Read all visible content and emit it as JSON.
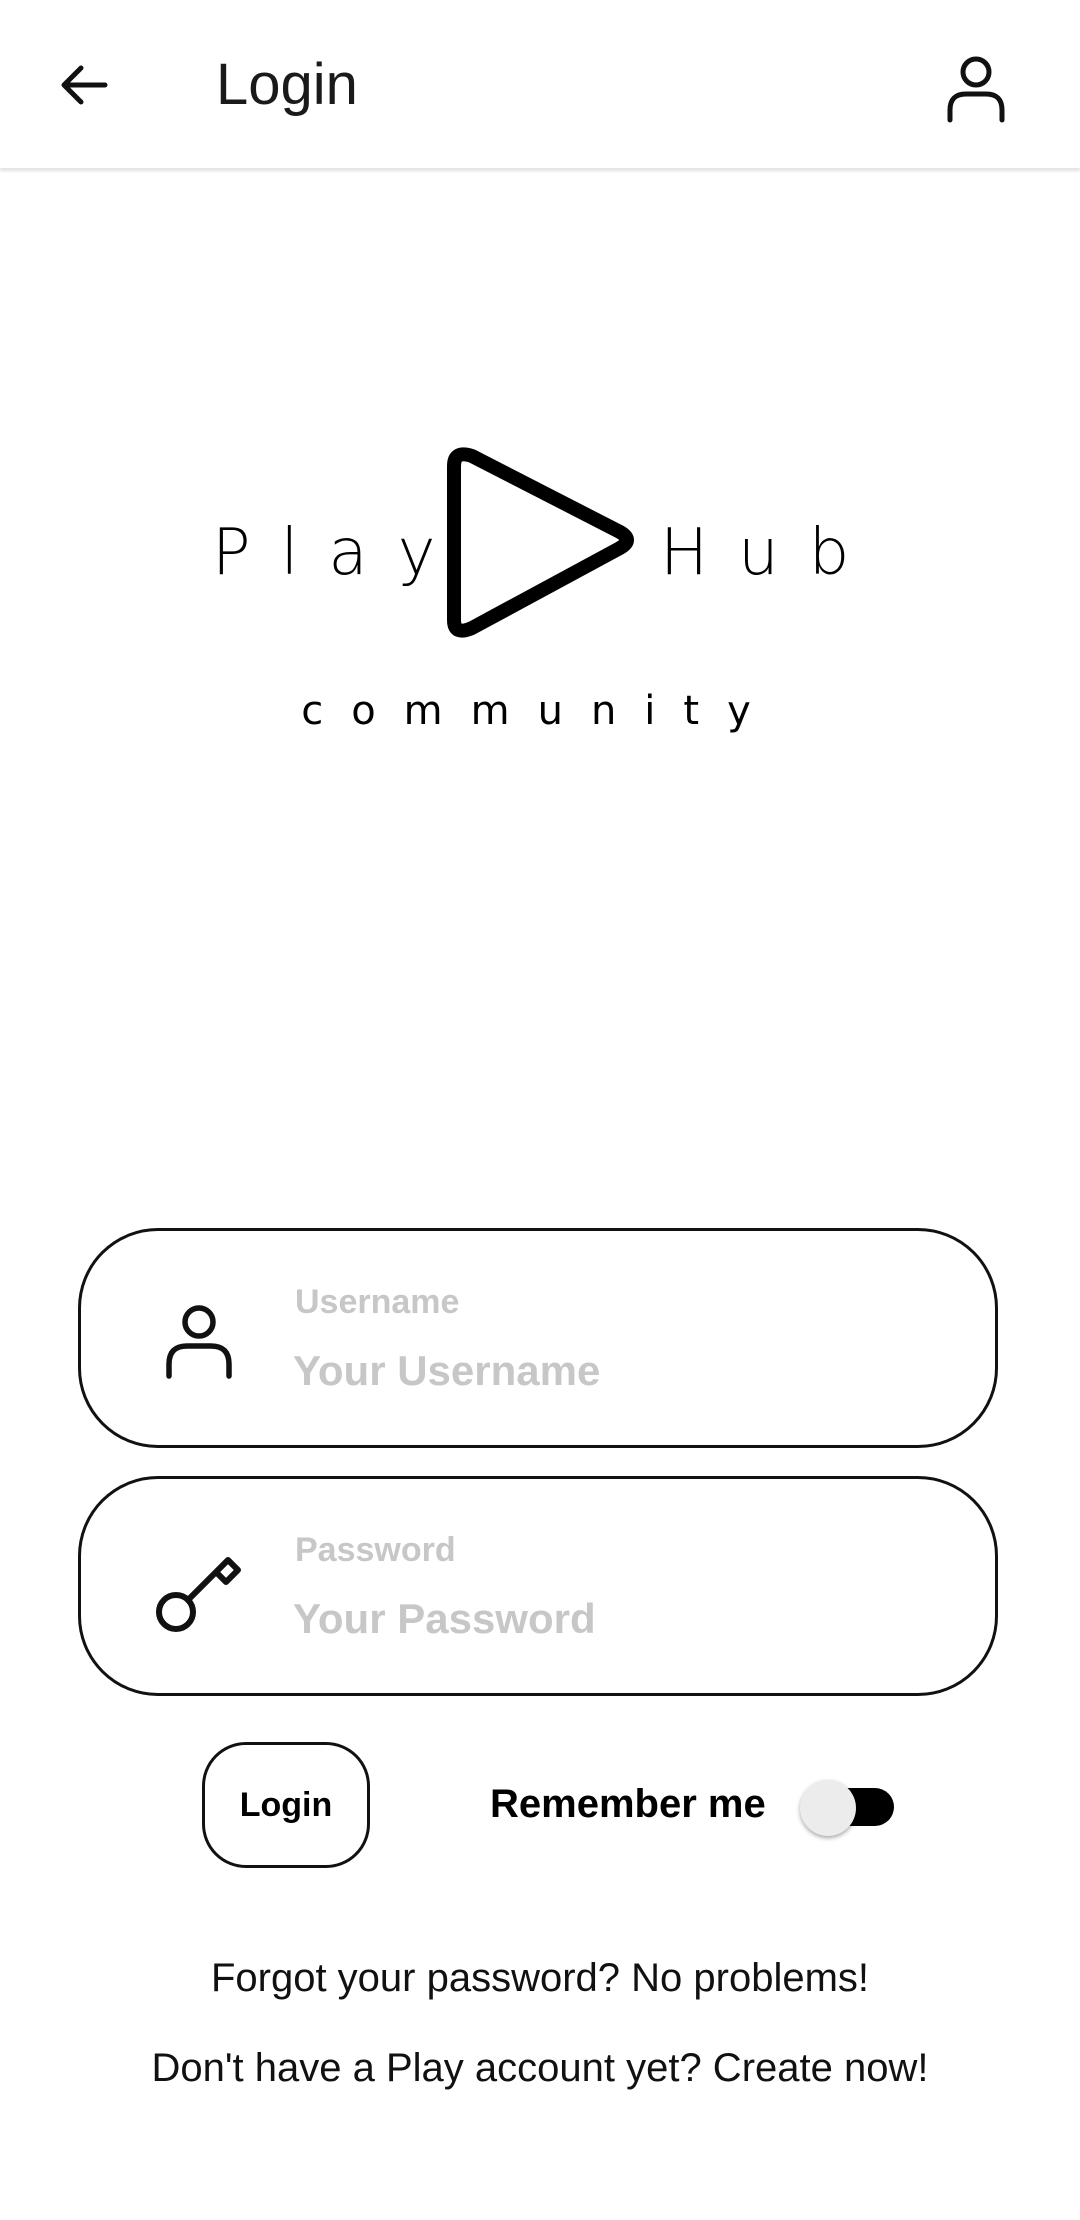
{
  "topbar": {
    "back_icon": "arrow-left-icon",
    "title": "Login",
    "profile_icon": "user-icon"
  },
  "logo": {
    "word_left": "Play",
    "word_right": "Hub",
    "subtitle": "community",
    "play_icon": "play-triangle-icon"
  },
  "username": {
    "icon": "user-icon",
    "label": "Username",
    "placeholder": "Your Username",
    "value": ""
  },
  "password": {
    "icon": "key-icon",
    "label": "Password",
    "placeholder": "Your Password",
    "value": ""
  },
  "actions": {
    "login_label": "Login",
    "remember_label": "Remember me",
    "remember_on": false
  },
  "links": {
    "forgot": "Forgot your password? No problems!",
    "create": "Don't have a Play account yet? Create now!"
  },
  "colors": {
    "background": "#ffffff",
    "foreground": "#000000",
    "placeholder": "#c7c7c7",
    "toggle_track": "#000000",
    "toggle_thumb": "#ececec"
  }
}
